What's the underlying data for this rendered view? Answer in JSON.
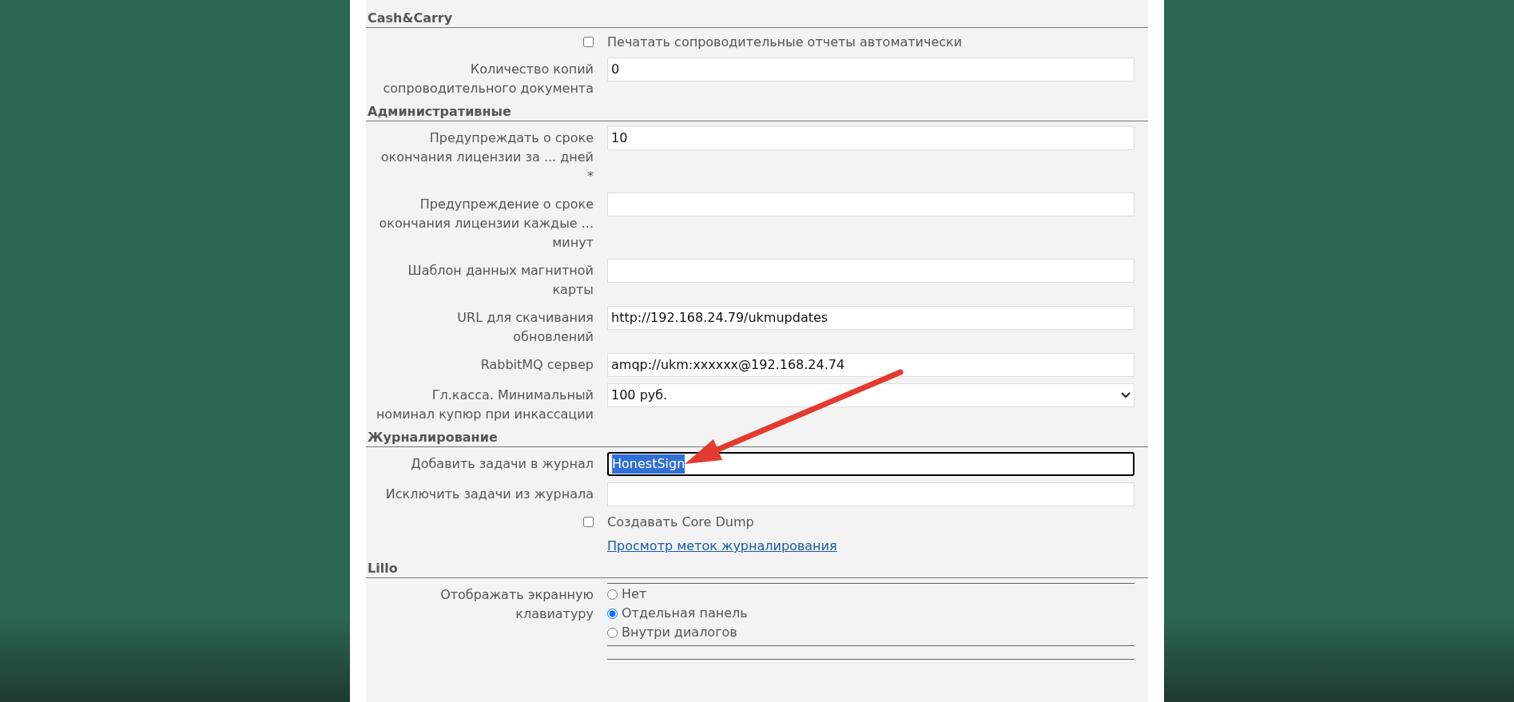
{
  "sections": [
    {
      "title": "Cash&Carry",
      "rows": [
        {
          "kind": "checkbox",
          "text": "Печатать сопроводительные отчеты автоматически",
          "checked": false
        },
        {
          "kind": "text",
          "label": "Количество копий сопроводительного документа",
          "value": "0",
          "focused": false
        }
      ]
    },
    {
      "title": "Административные",
      "rows": [
        {
          "kind": "text",
          "label": "Предупреждать о сроке окончания лицензии за ... дней *",
          "value": "10",
          "focused": false
        },
        {
          "kind": "text",
          "label": "Предупреждение о сроке окончания лицензии каждые ... минут",
          "value": "",
          "focused": false
        },
        {
          "kind": "text",
          "label": "Шаблон данных магнитной карты",
          "value": "",
          "focused": false
        },
        {
          "kind": "text",
          "label": "URL для скачивания обновлений",
          "value": "http://192.168.24.79/ukmupdates",
          "focused": false
        },
        {
          "kind": "text",
          "label": "RabbitMQ сервер",
          "value": "amqp://ukm:xxxxxx@192.168.24.74",
          "focused": false
        },
        {
          "kind": "select",
          "label": "Гл.касса. Минимальный номинал купюр при инкассации",
          "value": "100 руб."
        }
      ]
    },
    {
      "title": "Журналирование",
      "rows": [
        {
          "kind": "text",
          "label": "Добавить задачи в журнал",
          "value": "HonestSign",
          "focused": true
        },
        {
          "kind": "text",
          "label": "Исключить задачи из журнала",
          "value": "",
          "focused": false
        },
        {
          "kind": "checkbox",
          "text": "Создавать Core Dump",
          "checked": false
        },
        {
          "kind": "link",
          "text": "Просмотр меток журналирования"
        }
      ]
    },
    {
      "title": "Lillo",
      "rows": [
        {
          "kind": "radio",
          "label": "Отображать экранную клавиатуру",
          "options": [
            {
              "text": "Нет",
              "selected": false
            },
            {
              "text": "Отдельная панель",
              "selected": true
            },
            {
              "text": "Внутри диалогов",
              "selected": false
            }
          ]
        }
      ]
    }
  ]
}
